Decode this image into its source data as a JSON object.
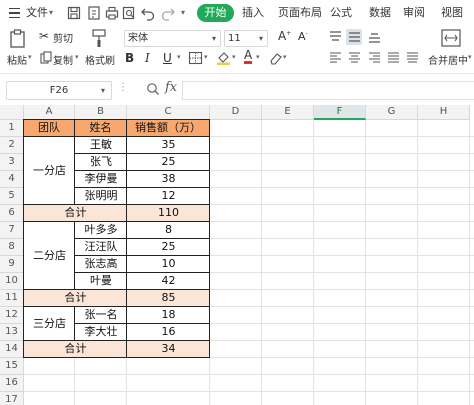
{
  "menu": {
    "file_label": "文件",
    "start_label": "开始",
    "tabs": [
      "插入",
      "页面布局",
      "公式",
      "数据",
      "审阅",
      "视图"
    ]
  },
  "ribbon": {
    "cut_label": "剪切",
    "paste_label": "粘贴",
    "copy_label": "复制",
    "format_painter_label": "格式刷",
    "font_name": "宋体",
    "font_size": "11",
    "merge_label": "合并居中"
  },
  "formula_bar": {
    "cell_ref": "F26",
    "fx_label": "fx",
    "formula_value": ""
  },
  "sheet": {
    "columns": [
      "A",
      "B",
      "C",
      "D",
      "E",
      "F",
      "G",
      "H"
    ],
    "selected_column": "F",
    "rows": [
      "1",
      "2",
      "3",
      "4",
      "5",
      "6",
      "7",
      "8",
      "9",
      "10",
      "11",
      "12",
      "13",
      "14",
      "15",
      "16",
      "17"
    ],
    "table": {
      "headers": [
        "团队",
        "姓名",
        "销售额（万）"
      ],
      "groups": [
        {
          "team": "一分店",
          "members": [
            [
              "王敏",
              "35"
            ],
            [
              "张飞",
              "25"
            ],
            [
              "李伊曼",
              "38"
            ],
            [
              "张明明",
              "12"
            ]
          ],
          "total_label": "合计",
          "total": "110"
        },
        {
          "team": "二分店",
          "members": [
            [
              "叶多多",
              "8"
            ],
            [
              "汪汪队",
              "25"
            ],
            [
              "张志高",
              "10"
            ],
            [
              "叶曼",
              "42"
            ]
          ],
          "total_label": "合计",
          "total": "85"
        },
        {
          "team": "三分店",
          "members": [
            [
              "张一名",
              "18"
            ],
            [
              "李大壮",
              "16"
            ]
          ],
          "total_label": "合计",
          "total": "34"
        }
      ]
    }
  },
  "colors": {
    "accent_green": "#22a85a",
    "header_fill": "#f7a86f",
    "total_fill": "#fbe5d6"
  }
}
